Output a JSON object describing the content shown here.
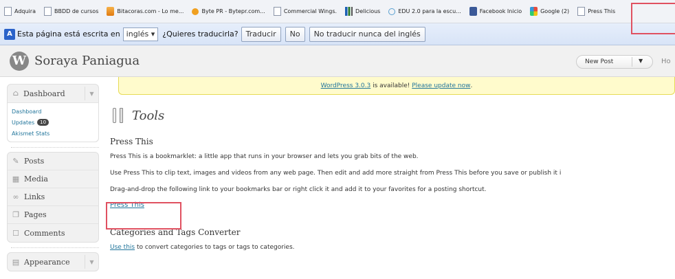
{
  "bookmarks": [
    {
      "label": "Adquira",
      "icon": "page-icon"
    },
    {
      "label": "BBDD de cursos",
      "icon": "page-icon"
    },
    {
      "label": "Bitacoras.com - Lo me...",
      "icon": "bitacoras-icon"
    },
    {
      "label": "Byte PR - Bytepr.com...",
      "icon": "bytepr-icon"
    },
    {
      "label": "Commercial Wings.",
      "icon": "page-icon"
    },
    {
      "label": "Delicious",
      "icon": "delicious-icon"
    },
    {
      "label": "EDU 2.0 para la escu...",
      "icon": "edu-icon"
    },
    {
      "label": "Facebook Inicio",
      "icon": "facebook-icon"
    },
    {
      "label": "Google (2)",
      "icon": "google-icon"
    },
    {
      "label": "Press This",
      "icon": "page-icon"
    }
  ],
  "translate_bar": {
    "text": "Esta página está escrita en",
    "language": "inglés",
    "question": "¿Quieres traducirla?",
    "translate_btn": "Traducir",
    "no_btn": "No",
    "never_btn": "No traducir nunca del inglés"
  },
  "header": {
    "site_name": "Soraya Paniagua",
    "new_post": "New Post",
    "howdy": "Ho"
  },
  "sidebar": {
    "dashboard": "Dashboard",
    "sub": {
      "dashboard": "Dashboard",
      "updates": "Updates",
      "updates_count": "10",
      "akismet": "Akismet Stats"
    },
    "items": [
      {
        "label": "Posts",
        "icon": "pushpin-icon"
      },
      {
        "label": "Media",
        "icon": "media-icon"
      },
      {
        "label": "Links",
        "icon": "links-icon"
      },
      {
        "label": "Pages",
        "icon": "pages-icon"
      },
      {
        "label": "Comments",
        "icon": "comments-icon"
      }
    ],
    "appearance": "Appearance"
  },
  "nag": {
    "text": "WordPress 3.0.3",
    "text2": " is available! ",
    "link": "Please update now",
    "end": "."
  },
  "main": {
    "title": "Tools",
    "press_heading": "Press This",
    "p1": "Press This is a bookmarklet: a little app that runs in your browser and lets you grab bits of the web.",
    "p2": "Use Press This to clip text, images and videos from any web page. Then edit and add more straight from Press This before you save or publish it i",
    "p3": "Drag-and-drop the following link to your bookmarks bar or right click it and add it to your favorites for a posting shortcut.",
    "press_link": "Press This",
    "cat_heading": "Categories and Tags Converter",
    "use_this": "Use this",
    "cat_text": " to convert categories to tags or tags to categories."
  }
}
